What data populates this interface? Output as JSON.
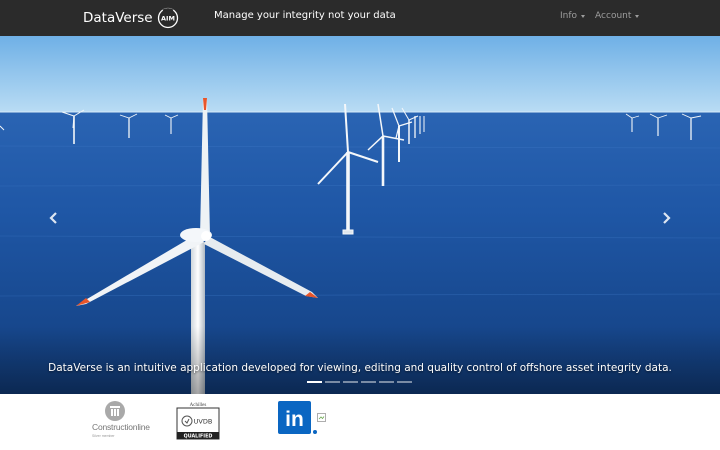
{
  "navbar": {
    "brand_name": "DataVerse",
    "brand_badge": "AIM",
    "tagline": "Manage your integrity not your data",
    "menu": [
      {
        "label": "Info",
        "icon": "caret-down-icon"
      },
      {
        "label": "Account",
        "icon": "caret-down-icon"
      }
    ]
  },
  "carousel": {
    "image": "offshore-wind-farm-photo",
    "caption": "DataVerse is an intuitive application developed for viewing, editing and quality control of offshore asset integrity data.",
    "slide_count": 6,
    "active_slide": 1,
    "prev_icon": "chevron-left-icon",
    "next_icon": "chevron-right-icon"
  },
  "footer": {
    "logos": [
      {
        "name": "Constructionline",
        "sub": "Silver member"
      },
      {
        "name": "Achilles",
        "badge_text": "UVDB",
        "status": "QUALIFIED"
      },
      {
        "name": "LinkedIn",
        "text": "in"
      }
    ]
  },
  "colors": {
    "navbar_bg": "#2b2b2b",
    "nav_link": "#9d9d9d",
    "sea_blue": "#1c4f9c",
    "sky_blue": "#8ec3ea",
    "linkedin_blue": "#0a66c2",
    "blade_tip_orange": "#e8552a"
  }
}
